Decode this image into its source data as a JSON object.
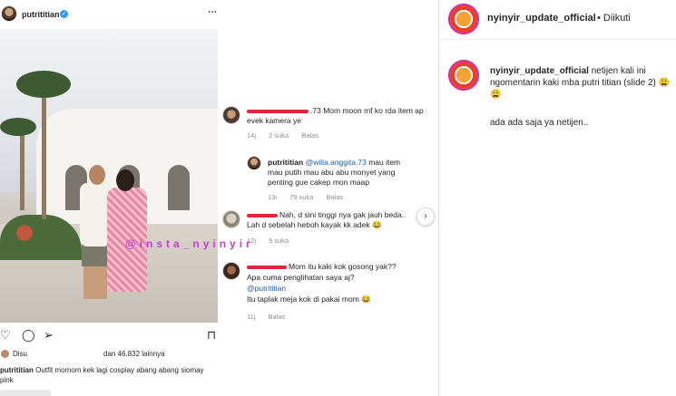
{
  "post": {
    "username": "putrititian",
    "more_icon": "⋯",
    "watermark": "@insta_nyinyir",
    "likes": {
      "liked_by": "Disu",
      "and_others": "dan 46.832 lainnya"
    },
    "caption": {
      "username": "putrititian",
      "text": "Outfit momom kek lagi cosplay abang abang siomay pink"
    }
  },
  "comments": [
    {
      "name_suffix": ".73",
      "text_line1": "Mom moon mf ko rda item ap",
      "text_line2": "evek kamera ye",
      "time": "14j",
      "likes": "2 suka",
      "reply": "Balas"
    },
    {
      "username": "putrititian",
      "mention": "@wilia.anggita.73",
      "text_line1": "mau item",
      "text_line2": "mau putih mau abu abu monyet yang",
      "text_line3": "penting gue cakep mon maap",
      "time": "13i",
      "likes": "79 suka",
      "reply": "Balas"
    },
    {
      "text_line1": "Nah, d sini tinggi nya gak jauh beda..",
      "text_line2": "Lah d sebelah heboh kayak kk adek 😂",
      "time": "12j",
      "likes": "5 suka"
    },
    {
      "text_line1": "Mom itu kaki kok gosong yak??",
      "text_line2": "Apa cuma penglihatan saya aj?",
      "mention": "@putrititian",
      "text_line3": "Itu taplak meja kok di pakai mom 😂",
      "time": "11j",
      "reply": "Balas"
    }
  ],
  "panel": {
    "username": "nyinyir_update_official",
    "follow_status": "• Diikuti",
    "caption_username": "nyinyir_update_official",
    "caption_text": "netijen kali ini ngomentarin kaki mba putri titian (slide 2) 😩😩",
    "caption_text2": "ada ada saja ya netijen.."
  },
  "colors": {
    "link": "#1f5ea8",
    "verified": "#3897f0",
    "watermark": "#c93cd4",
    "redaction": "#e0263a"
  },
  "icons": [
    "verified-icon",
    "heart-icon",
    "comment-icon",
    "share-icon",
    "bookmark-icon",
    "more-icon"
  ]
}
